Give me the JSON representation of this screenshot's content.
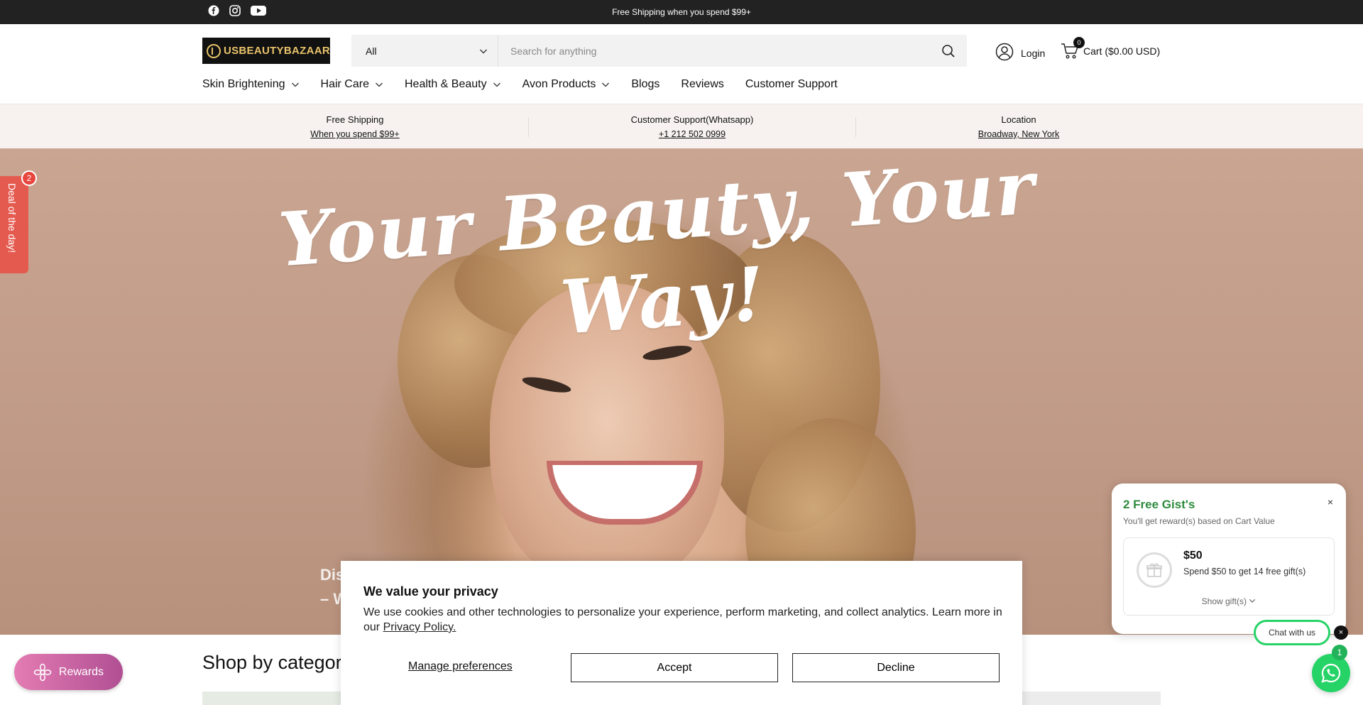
{
  "topbar": {
    "announcement": "Free Shipping when you spend $99+",
    "socials": [
      "facebook-icon",
      "instagram-icon",
      "youtube-icon"
    ]
  },
  "header": {
    "logo_text": "USBEAUTYBAZAAR",
    "search": {
      "category_selected": "All",
      "placeholder": "Search for anything"
    },
    "login_label": "Login",
    "cart_label": "Cart ($0.00 USD)",
    "cart_count": "0"
  },
  "nav": {
    "items": [
      {
        "label": "Skin Brightening",
        "dropdown": true
      },
      {
        "label": "Hair Care",
        "dropdown": true
      },
      {
        "label": "Health & Beauty",
        "dropdown": true
      },
      {
        "label": "Avon Products",
        "dropdown": true
      },
      {
        "label": "Blogs",
        "dropdown": false
      },
      {
        "label": "Reviews",
        "dropdown": false
      },
      {
        "label": "Customer Support",
        "dropdown": false
      }
    ]
  },
  "usp": [
    {
      "title": "Free Shipping",
      "sub": "When you spend $99+"
    },
    {
      "title": "Customer Support(Whatsapp)",
      "sub": "+1 212 502 0999"
    },
    {
      "title": "Location",
      "sub": "Broadway, New York"
    }
  ],
  "hero": {
    "title": "Your Beauty, Your Way!",
    "sub_line1": "Dis",
    "sub_line2": "– W"
  },
  "deal_tab": {
    "label": "Deal of the day!",
    "count": "2"
  },
  "shop": {
    "title": "Shop by category"
  },
  "rewards": {
    "label": "Rewards"
  },
  "cookie": {
    "title": "We value your privacy",
    "body": "We use cookies and other technologies to personalize your experience, perform marketing, and collect analytics. Learn more in our ",
    "policy_link": "Privacy Policy.",
    "manage_label": "Manage preferences",
    "accept_label": "Accept",
    "decline_label": "Decline"
  },
  "gifts": {
    "title": "2 Free Gist's",
    "subtitle": "You'll get reward(s) based on Cart Value",
    "amount": "$50",
    "description": "Spend $50 to get 14 free gift(s)",
    "show_label": "Show gift(s)",
    "close": "×"
  },
  "chat": {
    "pill_label": "Chat with us",
    "close": "×",
    "count": "1"
  },
  "colors": {
    "topbar": "#222222",
    "gift_title": "#2e8b3e",
    "whatsapp": "#25d366",
    "deal_tab": "#e55a4f",
    "rewards_start": "#e47cb3",
    "rewards_end": "#b04f93"
  }
}
